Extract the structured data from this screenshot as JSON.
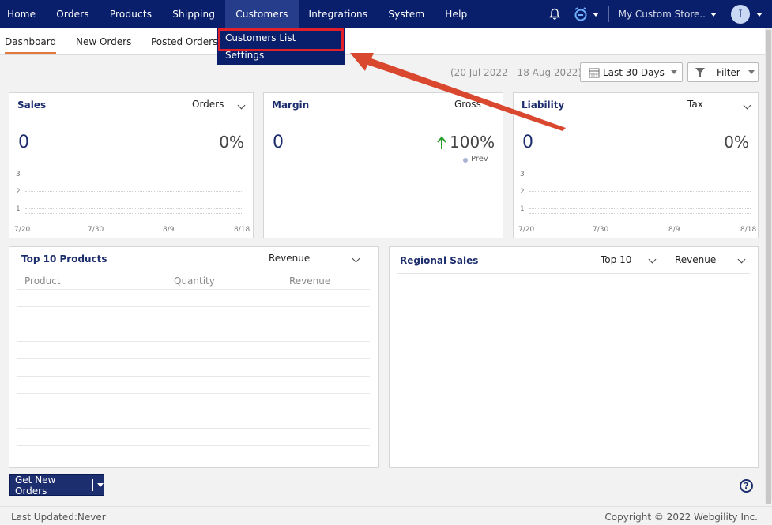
{
  "topnav": {
    "items": [
      "Home",
      "Orders",
      "Products",
      "Shipping",
      "Customers",
      "Integrations",
      "System",
      "Help"
    ],
    "active": "Customers",
    "store": "My Custom Store..",
    "avatar_initial": "I"
  },
  "subnav": {
    "tabs": [
      "Dashboard",
      "New Orders",
      "Posted Orders"
    ],
    "active": "Dashboard"
  },
  "dropdown": {
    "items": [
      "Customers List",
      "Settings"
    ],
    "highlighted": "Customers List"
  },
  "filters": {
    "date_range": "(20 Jul 2022 - 18 Aug 2022)",
    "period": "Last 30 Days",
    "filter_label": "Filter"
  },
  "cards": {
    "sales": {
      "title": "Sales",
      "metric": "Orders",
      "value": "0",
      "change": "0%",
      "y_ticks": [
        "3",
        "2",
        "1"
      ],
      "x_ticks": [
        "7/20",
        "7/30",
        "8/9",
        "8/18"
      ]
    },
    "margin": {
      "title": "Margin",
      "metric": "Gross",
      "value": "0",
      "change": "100%",
      "legend": "Prev"
    },
    "liability": {
      "title": "Liability",
      "metric": "Tax",
      "value": "0",
      "change": "0%",
      "y_ticks": [
        "3",
        "2",
        "1"
      ],
      "x_ticks": [
        "7/20",
        "7/30",
        "8/9",
        "8/18"
      ]
    },
    "top_products": {
      "title": "Top 10 Products",
      "metric": "Revenue",
      "columns": [
        "Product",
        "Quantity",
        "Revenue"
      ]
    },
    "regional": {
      "title": "Regional Sales",
      "top": "Top 10",
      "metric": "Revenue"
    }
  },
  "actions": {
    "get_orders": "Get New Orders",
    "help": "?"
  },
  "footer": {
    "last_updated": "Last Updated:Never",
    "copyright": "Copyright © 2022 Webgility Inc."
  },
  "colors": {
    "nav_bg": "#0a1f6b",
    "accent": "#e2793a",
    "highlight_red": "#e0202a",
    "arrow_red": "#d9482e",
    "up_green": "#2a9d2a"
  }
}
